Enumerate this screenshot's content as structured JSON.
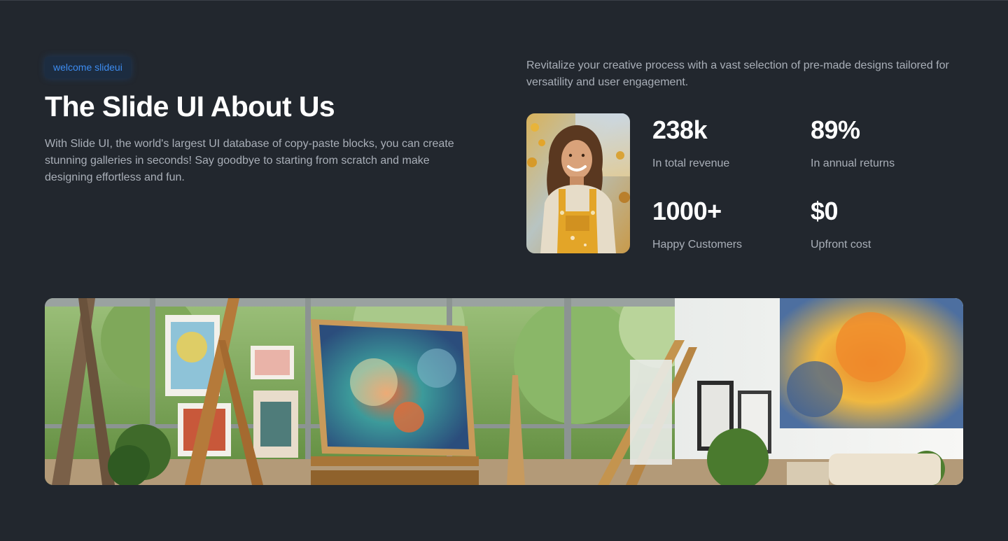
{
  "hero": {
    "badge": "welcome slideui",
    "title": "The Slide UI About Us",
    "lead": "With Slide UI, the world's largest UI database of copy-paste blocks, you can create stunning galleries in seconds! Say goodbye to starting from scratch and make designing effortless and fun.",
    "intro": "Revitalize your creative process with a vast selection of pre-made designs tailored for versatility and user engagement."
  },
  "stats": [
    {
      "value": "238k",
      "label": "In total revenue"
    },
    {
      "value": "89%",
      "label": "In annual returns"
    },
    {
      "value": "1000+",
      "label": "Happy Customers"
    },
    {
      "value": "$0",
      "label": "Upfront cost"
    }
  ],
  "colors": {
    "background": "#22272e",
    "accent": "#3d8cf0",
    "heading": "#ffffff",
    "body_text": "#a9afb8"
  }
}
